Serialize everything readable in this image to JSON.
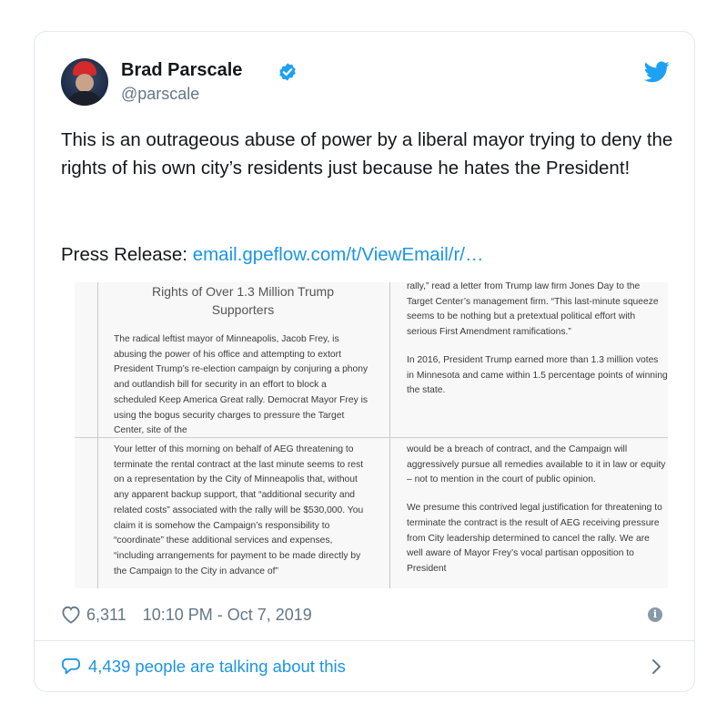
{
  "tweet": {
    "author_name": "Brad Parscale",
    "handle": "@parscale",
    "text": "This is an outrageous abuse of power by a liberal mayor trying to deny the rights of his own city’s residents just because he hates the President!",
    "press_label": "Press Release: ",
    "link_text": "email.gpeflow.com/t/ViewEmail/r/…",
    "likes": "6,311",
    "timestamp": "10:10 PM - Oct 7, 2019",
    "talking": "4,439 people are talking about this",
    "info_glyph": "i"
  },
  "document": {
    "title": "Rights of Over 1.3 Million Trump Supporters",
    "left_top": "The radical leftist mayor of Minneapolis, Jacob Frey, is abusing the power of his office and attempting to extort President Trump’s re-election campaign by conjuring a phony and outlandish bill for security in an effort to block a scheduled Keep America Great rally. Democrat Mayor Frey is using the bogus security charges to pressure the Target Center, site of the",
    "left_bottom": "Your letter of this morning on behalf of AEG threatening to terminate the rental contract at the last minute seems to rest on a representation by the City of Minneapolis that, without any apparent backup support, that “additional security and related costs” associated with the rally will be $530,000. You claim it is somehow the Campaign’s responsibility to “coordinate” these additional services and expenses, “including arrangements for payment to be made directly by the Campaign to the City in advance of”",
    "right_top_1": "rally,” read a letter from Trump law firm Jones Day to the Target Center’s management firm. “This last-minute squeeze seems to be nothing but a pretextual political effort with serious First Amendment ramifications.”",
    "right_top_2": "In 2016, President Trump earned more than 1.3 million votes in Minnesota and came within 1.5 percentage points of winning the state.",
    "right_bottom_1": "would be a breach of contract, and the Campaign will aggressively pursue all remedies available to it in law or equity – not to mention in the court of public opinion.",
    "right_bottom_2": "We presume this contrived legal justification for threatening to terminate the contract is the result of AEG receiving pressure from City leadership determined to cancel the rally. We are well aware of Mayor Frey’s vocal partisan opposition to President"
  },
  "colors": {
    "link": "#1b95e0",
    "meta_text": "#657786",
    "verified": "#1da1f2",
    "like_icon": "#657786"
  },
  "icons": [
    "avatar",
    "verified-badge-icon",
    "twitter-bird-icon",
    "heart-icon",
    "info-icon",
    "speech-bubble-icon",
    "chevron-right-icon"
  ]
}
